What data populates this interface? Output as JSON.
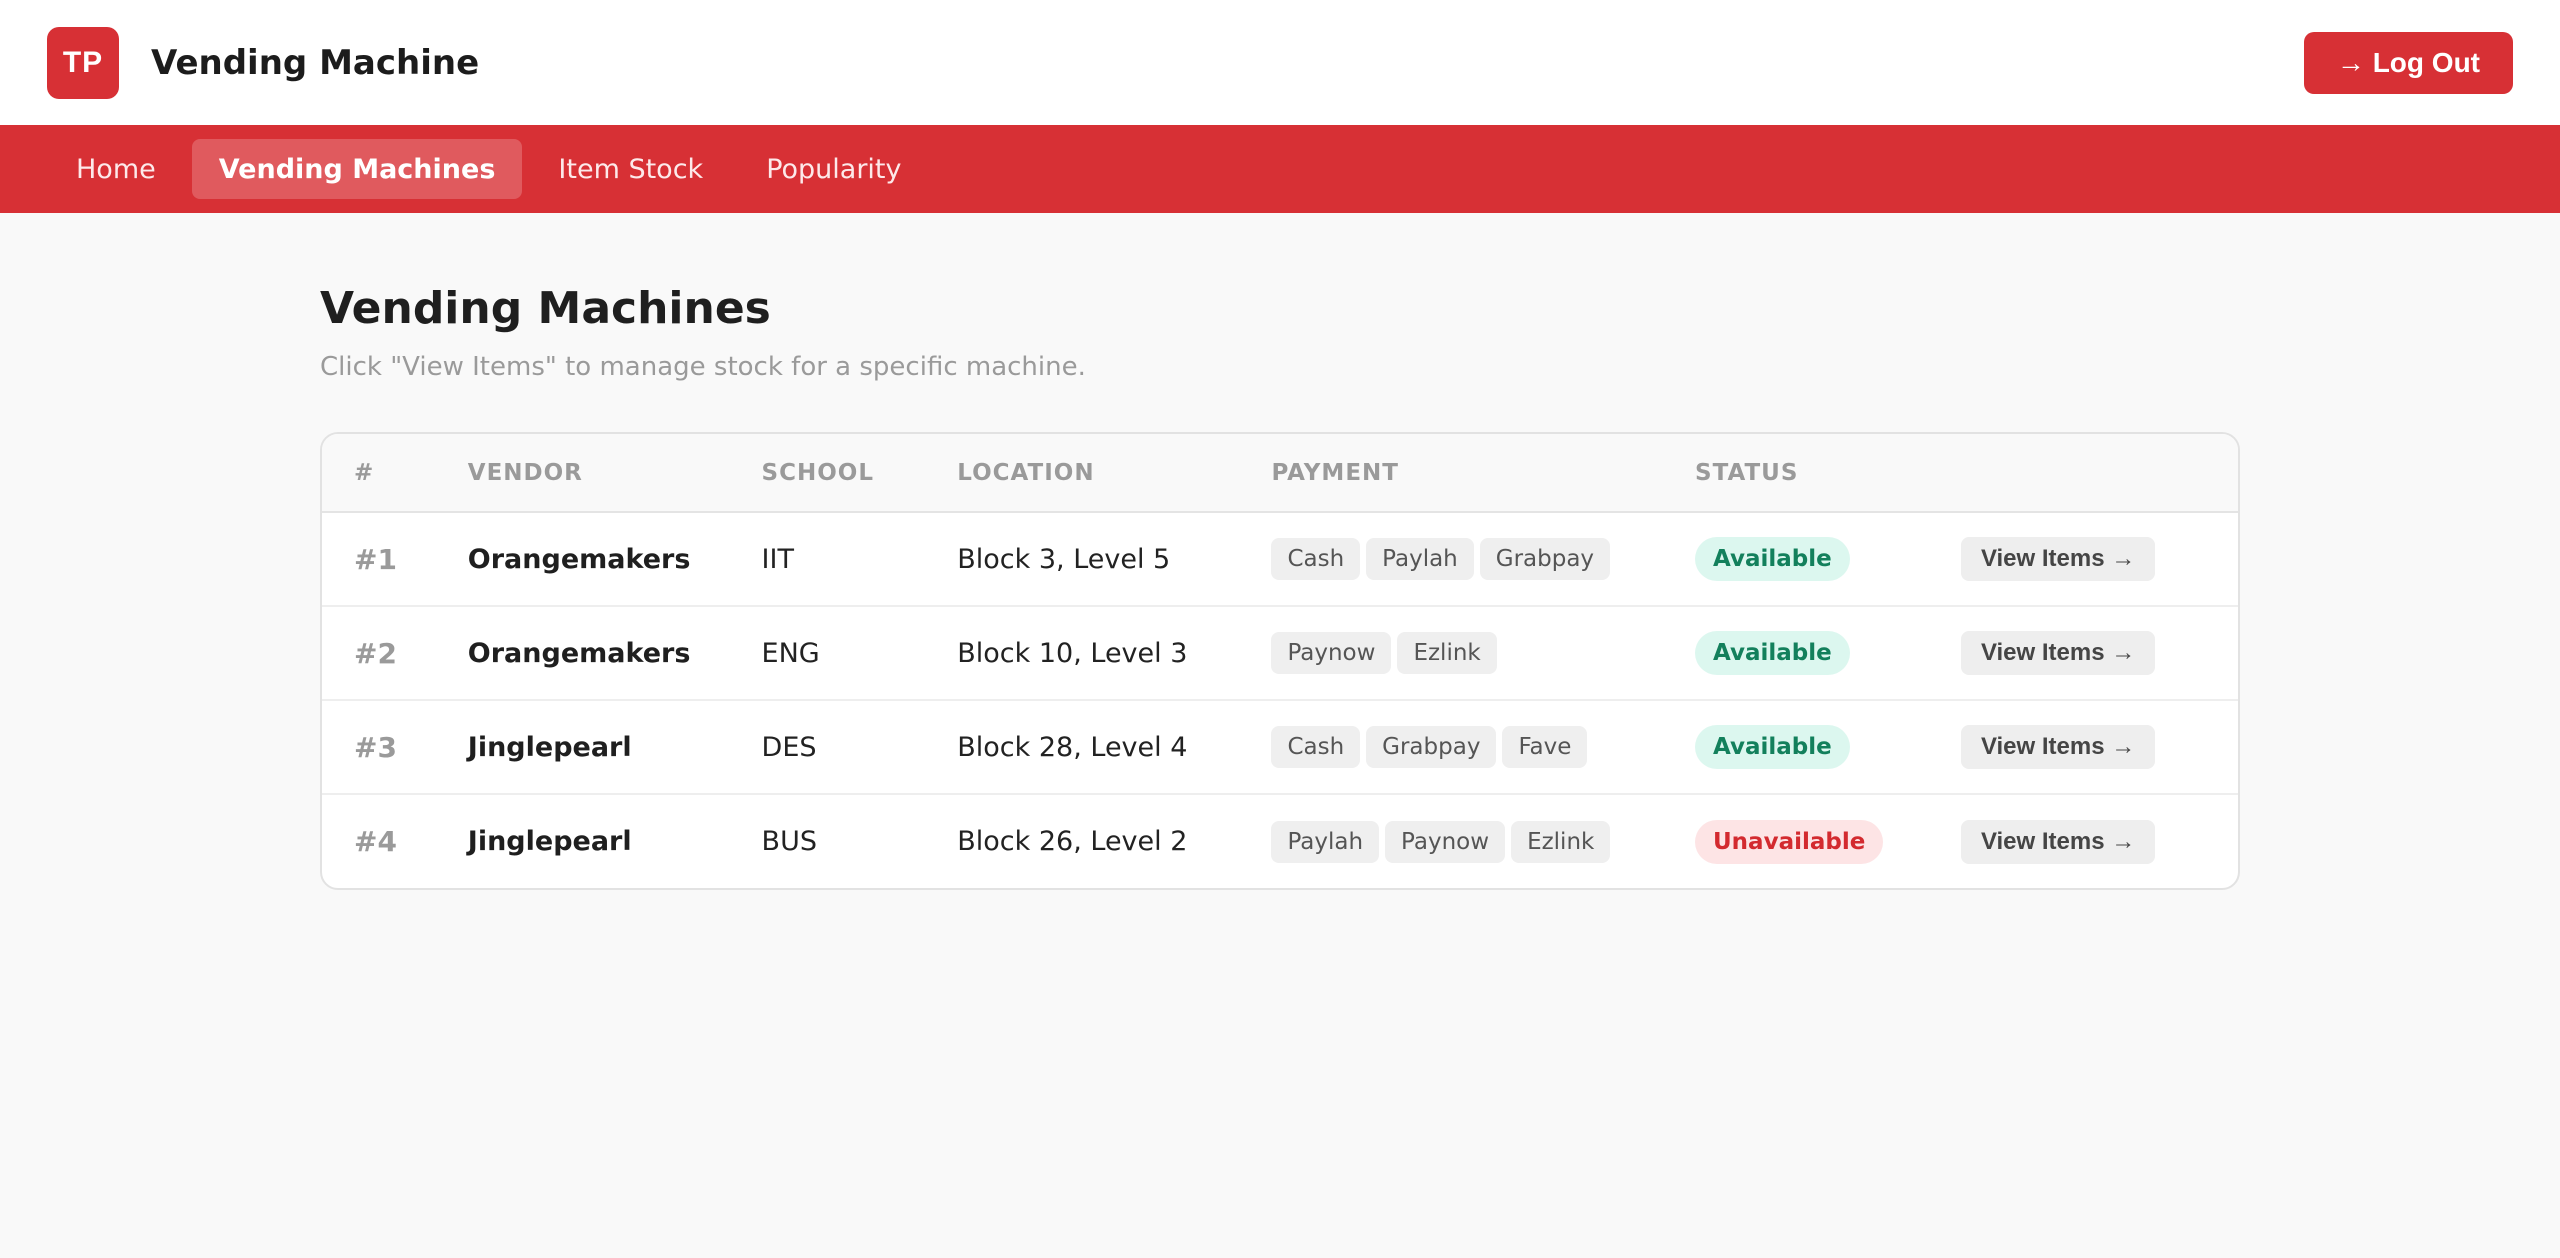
{
  "header": {
    "logo_text": "TP",
    "title": "Vending Machine",
    "logout_label": "→ Log Out"
  },
  "nav": {
    "items": [
      {
        "label": "Home",
        "active": false
      },
      {
        "label": "Vending Machines",
        "active": true
      },
      {
        "label": "Item Stock",
        "active": false
      },
      {
        "label": "Popularity",
        "active": false
      }
    ]
  },
  "page": {
    "title": "Vending Machines",
    "subtitle": "Click \"View Items\" to manage stock for a specific machine."
  },
  "table": {
    "columns": [
      "#",
      "VENDOR",
      "SCHOOL",
      "LOCATION",
      "PAYMENT",
      "STATUS",
      ""
    ],
    "rows": [
      {
        "num": "#1",
        "vendor": "Orangemakers",
        "school": "IIT",
        "location": "Block 3, Level 5",
        "payments": [
          "Cash",
          "Paylah",
          "Grabpay"
        ],
        "status": "Available",
        "status_type": "ok",
        "action": "View Items →"
      },
      {
        "num": "#2",
        "vendor": "Orangemakers",
        "school": "ENG",
        "location": "Block 10, Level 3",
        "payments": [
          "Paynow",
          "Ezlink"
        ],
        "status": "Available",
        "status_type": "ok",
        "action": "View Items →"
      },
      {
        "num": "#3",
        "vendor": "Jinglepearl",
        "school": "DES",
        "location": "Block 28, Level 4",
        "payments": [
          "Cash",
          "Grabpay",
          "Fave"
        ],
        "status": "Available",
        "status_type": "ok",
        "action": "View Items →"
      },
      {
        "num": "#4",
        "vendor": "Jinglepearl",
        "school": "BUS",
        "location": "Block 26, Level 2",
        "payments": [
          "Paylah",
          "Paynow",
          "Ezlink"
        ],
        "status": "Unavailable",
        "status_type": "bad",
        "action": "View Items →"
      }
    ]
  },
  "colors": {
    "brand_red": "#d73035",
    "status_available": "#13805c",
    "status_unavailable": "#d32a2f"
  }
}
